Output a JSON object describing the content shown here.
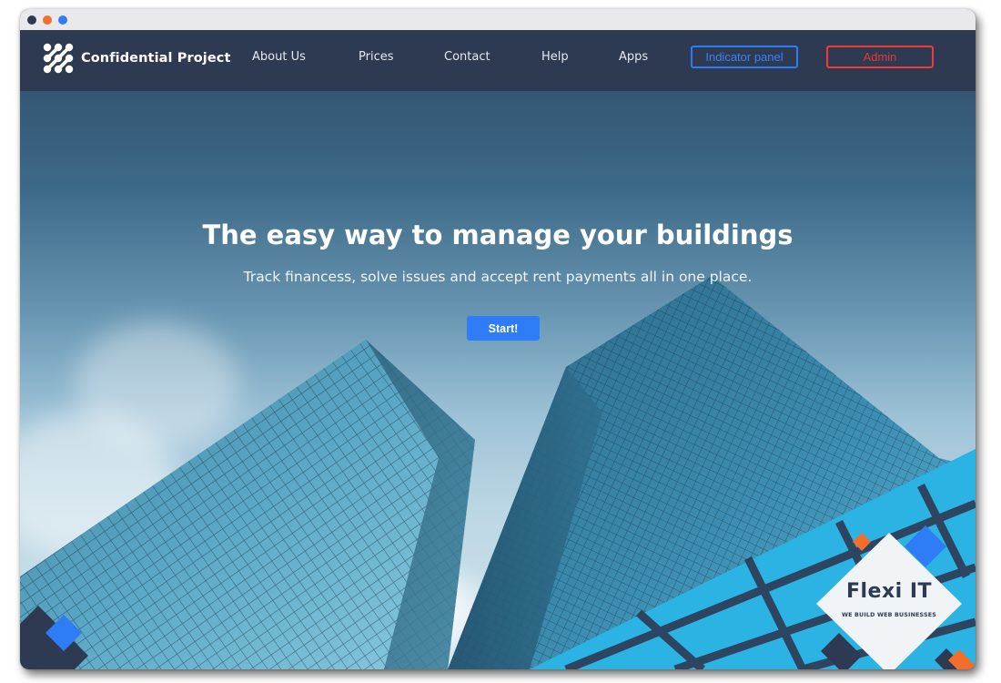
{
  "window": {
    "controls": [
      "close",
      "minimize",
      "maximize"
    ]
  },
  "nav": {
    "brand": "Confidential Project",
    "brand_icon": "dot-grid-logo-icon",
    "links": [
      {
        "label": "About Us"
      },
      {
        "label": "Prices"
      },
      {
        "label": "Contact"
      },
      {
        "label": "Help"
      },
      {
        "label": "Apps"
      }
    ],
    "indicator_panel": "Indicator panel",
    "admin": "Admin"
  },
  "hero": {
    "title": "The easy way to manage your buildings",
    "subtitle": "Track financess, solve issues and accept rent payments all in one place.",
    "cta": "Start!"
  },
  "watermark": {
    "name": "Flexi IT",
    "tagline": "WE BUILD WEB BUSINESSES"
  },
  "colors": {
    "navbar": "#2e3a52",
    "accent_blue": "#2f7df6",
    "accent_red": "#ef3b3b",
    "accent_orange": "#f36d2b"
  }
}
